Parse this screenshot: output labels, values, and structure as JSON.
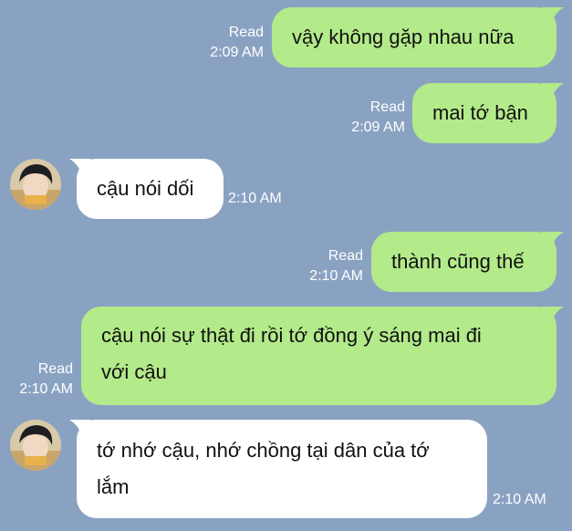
{
  "messages": [
    {
      "direction": "out",
      "text": "vậy không gặp nhau nữa",
      "status": "Read",
      "time": "2:09 AM"
    },
    {
      "direction": "out",
      "text": "mai tớ bận",
      "status": "Read",
      "time": "2:09 AM"
    },
    {
      "direction": "in",
      "text": "cậu nói dối",
      "time": "2:10 AM"
    },
    {
      "direction": "out",
      "text": "thành cũng thế",
      "status": "Read",
      "time": "2:10 AM"
    },
    {
      "direction": "out",
      "text": "cậu nói sự thật đi rồi tớ đồng ý sáng mai đi với cậu",
      "line1": "cậu nói sự thật đi rồi tớ đồng ý sáng mai đi",
      "line2": "với cậu",
      "status": "Read",
      "time": "2:10 AM"
    },
    {
      "direction": "in",
      "text": "tớ nhớ cậu, nhớ chồng tại dân của tớ lắm",
      "line1": "tớ nhớ cậu, nhớ chồng tại dân của tớ",
      "line2": "lắm",
      "time": "2:10 AM"
    }
  ],
  "colors": {
    "background": "#8aa2c2",
    "outgoing_bubble": "#b3ea8a",
    "incoming_bubble": "#ffffff",
    "meta_text": "#ffffff"
  },
  "icons": {
    "avatar": "contact-avatar"
  }
}
